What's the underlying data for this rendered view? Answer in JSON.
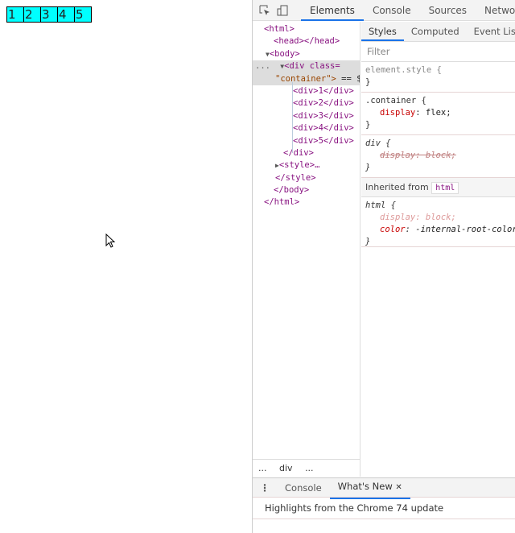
{
  "page": {
    "boxes": [
      "1",
      "2",
      "3",
      "4",
      "5"
    ],
    "box_color": "#00ffff"
  },
  "devtools": {
    "tabs": [
      "Elements",
      "Console",
      "Sources",
      "Network"
    ],
    "active_tab": "Elements",
    "tree": {
      "html_open": "<html>",
      "head": "<head></head>",
      "body_open": "<body>",
      "div_open_1": "<div class=",
      "div_open_2": "\"container\">",
      "div_eq": " == $0",
      "children": [
        "<div>1</div>",
        "<div>2</div>",
        "<div>3</div>",
        "<div>4</div>",
        "<div>5</div>"
      ],
      "div_close": "</div>",
      "style": "<style>…",
      "style_close": "</style>",
      "body_close": "</body>",
      "html_close": "</html>",
      "dots": "..."
    },
    "breadcrumb": {
      "left": "...",
      "item": "div",
      "right": "..."
    },
    "styles_tabs": [
      "Styles",
      "Computed",
      "Event Listeners"
    ],
    "filter_placeholder": "Filter",
    "rules": {
      "element_style": "element.style {",
      "close": "}",
      "container_sel": ".container {",
      "container_prop": "display",
      "container_val": "flex;",
      "div_sel": "div {",
      "div_decl": "display: block;",
      "inherited_label": "Inherited from",
      "inherited_badge": "html",
      "html_sel": "html {",
      "html_prop1": "display: block;",
      "html_prop2": "color",
      "html_val2": "-internal-root-color"
    },
    "drawer": {
      "tabs": [
        "Console",
        "What's New"
      ],
      "close": "✕",
      "content": "Highlights from the Chrome 74 update"
    }
  }
}
